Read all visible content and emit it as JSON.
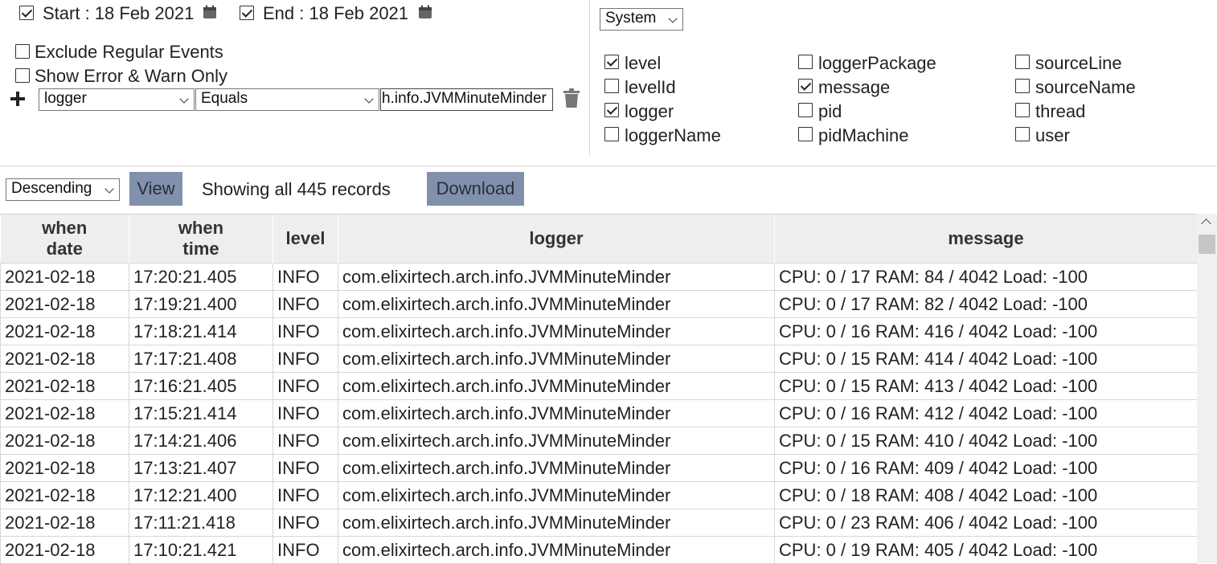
{
  "date_range": {
    "start_checked": true,
    "start_label": "Start : 18 Feb 2021",
    "end_checked": true,
    "end_label": "End : 18 Feb 2021"
  },
  "filters": {
    "exclude_regular": {
      "label": "Exclude Regular Events",
      "checked": false
    },
    "error_warn_only": {
      "label": "Show Error & Warn Only",
      "checked": false
    },
    "condition": {
      "field": "logger",
      "operator": "Equals",
      "value": "h.info.JVMMinuteMinder"
    }
  },
  "source_select": "System",
  "columns": [
    {
      "label": "level",
      "checked": true
    },
    {
      "label": "levelId",
      "checked": false
    },
    {
      "label": "logger",
      "checked": true
    },
    {
      "label": "loggerName",
      "checked": false
    },
    {
      "label": "loggerPackage",
      "checked": false
    },
    {
      "label": "message",
      "checked": true
    },
    {
      "label": "pid",
      "checked": false
    },
    {
      "label": "pidMachine",
      "checked": false
    },
    {
      "label": "sourceLine",
      "checked": false
    },
    {
      "label": "sourceName",
      "checked": false
    },
    {
      "label": "thread",
      "checked": false
    },
    {
      "label": "user",
      "checked": false
    }
  ],
  "toolbar": {
    "sort_order": "Descending",
    "view_label": "View",
    "status_text": "Showing all 445 records",
    "download_label": "Download"
  },
  "table": {
    "headers": [
      {
        "line1": "when",
        "line2": "date"
      },
      {
        "line1": "when",
        "line2": "time"
      },
      {
        "line1": "level",
        "line2": ""
      },
      {
        "line1": "logger",
        "line2": ""
      },
      {
        "line1": "message",
        "line2": ""
      }
    ],
    "rows": [
      [
        "2021-02-18",
        "17:20:21.405",
        "INFO",
        "com.elixirtech.arch.info.JVMMinuteMinder",
        "CPU: 0 / 17 RAM: 84 / 4042 Load: -100"
      ],
      [
        "2021-02-18",
        "17:19:21.400",
        "INFO",
        "com.elixirtech.arch.info.JVMMinuteMinder",
        "CPU: 0 / 17 RAM: 82 / 4042 Load: -100"
      ],
      [
        "2021-02-18",
        "17:18:21.414",
        "INFO",
        "com.elixirtech.arch.info.JVMMinuteMinder",
        "CPU: 0 / 16 RAM: 416 / 4042 Load: -100"
      ],
      [
        "2021-02-18",
        "17:17:21.408",
        "INFO",
        "com.elixirtech.arch.info.JVMMinuteMinder",
        "CPU: 0 / 15 RAM: 414 / 4042 Load: -100"
      ],
      [
        "2021-02-18",
        "17:16:21.405",
        "INFO",
        "com.elixirtech.arch.info.JVMMinuteMinder",
        "CPU: 0 / 15 RAM: 413 / 4042 Load: -100"
      ],
      [
        "2021-02-18",
        "17:15:21.414",
        "INFO",
        "com.elixirtech.arch.info.JVMMinuteMinder",
        "CPU: 0 / 16 RAM: 412 / 4042 Load: -100"
      ],
      [
        "2021-02-18",
        "17:14:21.406",
        "INFO",
        "com.elixirtech.arch.info.JVMMinuteMinder",
        "CPU: 0 / 15 RAM: 410 / 4042 Load: -100"
      ],
      [
        "2021-02-18",
        "17:13:21.407",
        "INFO",
        "com.elixirtech.arch.info.JVMMinuteMinder",
        "CPU: 0 / 16 RAM: 409 / 4042 Load: -100"
      ],
      [
        "2021-02-18",
        "17:12:21.400",
        "INFO",
        "com.elixirtech.arch.info.JVMMinuteMinder",
        "CPU: 0 / 18 RAM: 408 / 4042 Load: -100"
      ],
      [
        "2021-02-18",
        "17:11:21.418",
        "INFO",
        "com.elixirtech.arch.info.JVMMinuteMinder",
        "CPU: 0 / 23 RAM: 406 / 4042 Load: -100"
      ],
      [
        "2021-02-18",
        "17:10:21.421",
        "INFO",
        "com.elixirtech.arch.info.JVMMinuteMinder",
        "CPU: 0 / 19 RAM: 405 / 4042 Load: -100"
      ]
    ]
  },
  "icons": {
    "calendar": "calendar-icon",
    "add": "plus-icon",
    "delete": "trash-icon"
  },
  "colors": {
    "button_bg": "#8190ad",
    "header_bg": "#eeeeee"
  }
}
